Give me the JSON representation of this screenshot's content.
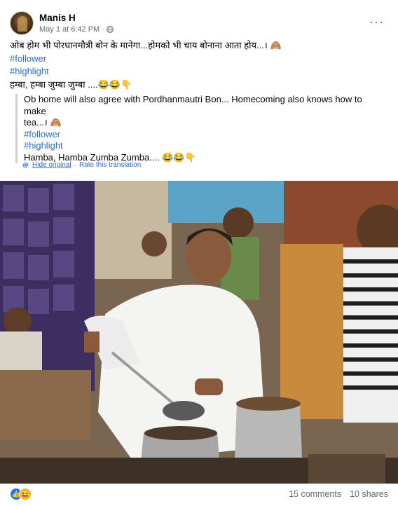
{
  "post": {
    "author": "Manis H",
    "date": "May 1 at 6:42 PM",
    "separator": "·",
    "more": "···",
    "text_line1": "ओब होम भी पोरधानमौत्री बोन के मानेगा...होमको भी चाय बोनाना आता होय...। 🙈",
    "hashtag1": "#follower",
    "hashtag2": "#highlight",
    "text_line2": "हम्बा, हम्बा जुम्बा जुम्बा ....😂😂👇"
  },
  "translation": {
    "line1": "Ob home will also agree with Pordhanmautri Bon... Homecoming also knows how to make",
    "line2": "tea...। 🙈",
    "hashtag1": "#follower",
    "hashtag2": "#highlight",
    "line3": "Hamba, Hamba Zumba Zumba.... 😂😂👇",
    "hide_link": "Hide original",
    "separator": "·",
    "rate_link": "Rate this translation"
  },
  "footer": {
    "comments": "15 comments",
    "shares": "10 shares"
  },
  "icons": {
    "reactions": [
      "like-icon",
      "haha-icon"
    ],
    "like_color": "#1877f2",
    "haha_color": "#f7b125",
    "link_color": "#216fdb"
  }
}
